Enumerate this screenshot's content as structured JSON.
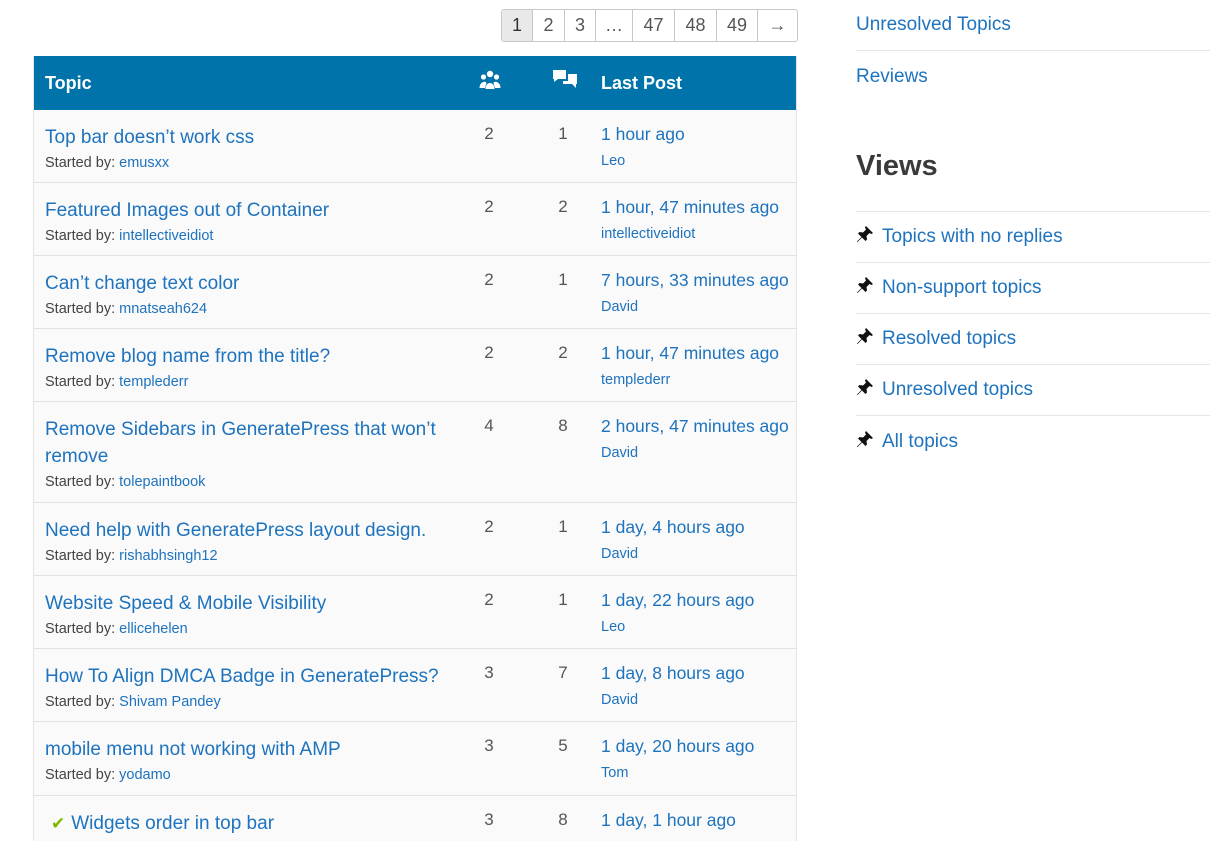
{
  "pagination": {
    "pages": [
      "1",
      "2",
      "3",
      "…",
      "47",
      "48",
      "49",
      "→"
    ],
    "current": "1"
  },
  "table": {
    "header_topic": "Topic",
    "header_voices_icon": "people-icon",
    "header_posts_icon": "speech-bubbles-icon",
    "header_last_post": "Last Post",
    "started_by_label": "Started by:",
    "rows": [
      {
        "title": "Top bar doesn’t work css",
        "starter": "emusxx",
        "voices": "2",
        "posts": "1",
        "freshness": "1 hour ago",
        "last_by": "Leo"
      },
      {
        "title": "Featured Images out of Container",
        "starter": "intellectiveidiot",
        "voices": "2",
        "posts": "2",
        "freshness": "1 hour, 47 minutes ago",
        "last_by": "intellectiveidiot"
      },
      {
        "title": "Can’t change text color",
        "starter": "mnatseah624",
        "voices": "2",
        "posts": "1",
        "freshness": "7 hours, 33 minutes ago",
        "last_by": "David"
      },
      {
        "title": "Remove blog name from the title?",
        "starter": "templederr",
        "voices": "2",
        "posts": "2",
        "freshness": "1 hour, 47 minutes ago",
        "last_by": "templederr"
      },
      {
        "title": "Remove Sidebars in GeneratePress that won’t remove",
        "starter": "tolepaintbook",
        "voices": "4",
        "posts": "8",
        "freshness": "2 hours, 47 minutes ago",
        "last_by": "David"
      },
      {
        "title": "Need help with GeneratePress layout design.",
        "starter": "rishabhsingh12",
        "voices": "2",
        "posts": "1",
        "freshness": "1 day, 4 hours ago",
        "last_by": "David"
      },
      {
        "title": "Website Speed & Mobile Visibility",
        "starter": "ellicehelen",
        "voices": "2",
        "posts": "1",
        "freshness": "1 day, 22 hours ago",
        "last_by": "Leo"
      },
      {
        "title": "How To Align DMCA Badge in GeneratePress?",
        "starter": "Shivam Pandey",
        "voices": "3",
        "posts": "7",
        "freshness": "1 day, 8 hours ago",
        "last_by": "David"
      },
      {
        "title": "mobile menu not working with AMP",
        "starter": "yodamo",
        "voices": "3",
        "posts": "5",
        "freshness": "1 day, 20 hours ago",
        "last_by": "Tom"
      },
      {
        "title": "Widgets order in top bar",
        "starter": "",
        "voices": "3",
        "posts": "8",
        "freshness": "1 day, 1 hour ago",
        "last_by": "",
        "resolved": true
      }
    ]
  },
  "sidebar": {
    "top_links": [
      "Unresolved Topics",
      "Reviews"
    ],
    "views_title": "Views",
    "views": [
      "Topics with no replies",
      "Non-support topics",
      "Resolved topics",
      "Unresolved topics",
      "All topics"
    ]
  },
  "colors": {
    "header_bg": "#0073aa",
    "link": "#1e73be",
    "resolved_check": "#7ab800"
  }
}
